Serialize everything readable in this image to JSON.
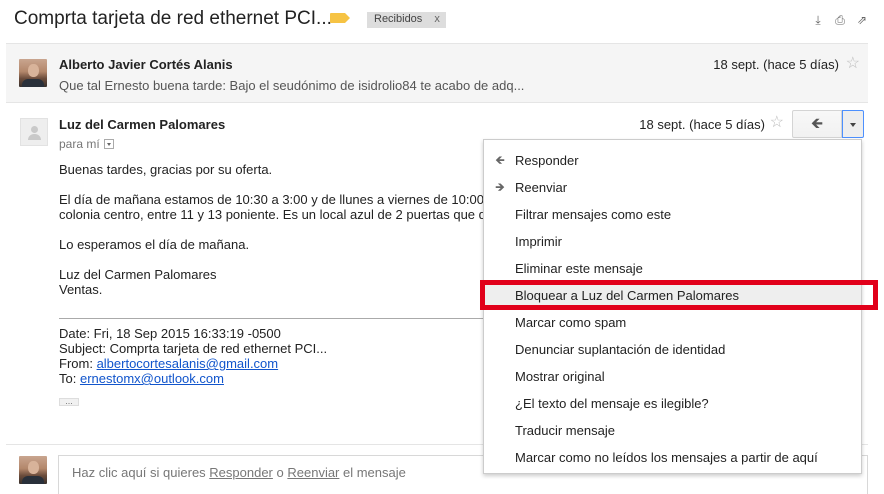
{
  "thread": {
    "subject": "Comprta tarjeta de red ethernet PCI...",
    "label_chip": "Recibidos",
    "label_chip_close": "x",
    "header_icons": [
      "download-icon",
      "print-icon",
      "open-new-window-icon"
    ]
  },
  "message1": {
    "sender": "Alberto Javier Cortés Alanis",
    "snippet": "Que tal Ernesto buena tarde: Bajo el seudónimo de isidrolio84 te acabo de adq...",
    "date": "18 sept. (hace 5 días)"
  },
  "message2": {
    "sender": "Luz del Carmen Palomares",
    "to": "para mí",
    "date": "18 sept. (hace 5 días)",
    "body": {
      "greeting": "Buenas tardes, gracias por su oferta.",
      "para_line1": "El día de mañana estamos de 10:30 a 3:00 y de llunes a viernes de 10:00",
      "para_line2": "colonia centro, entre 11 y 13 poniente. Es un local azul de 2 puertas que d",
      "closing": "Lo esperamos el día de mañana.",
      "signature_name": "Luz del Carmen Palomares",
      "signature_role": "Ventas."
    },
    "quoted": {
      "date_line": "Date: Fri, 18 Sep 2015 16:33:19 -0500",
      "subject_line": "Subject: Comprta tarjeta de red ethernet PCI...",
      "from_label": "From: ",
      "from_email": "albertocortesalanis@gmail.com",
      "to_label": "To: ",
      "to_email": "ernestomx@outlook.com",
      "expand": "..."
    }
  },
  "menu": {
    "items": [
      {
        "label": "Responder",
        "icon": "reply-icon"
      },
      {
        "label": "Reenviar",
        "icon": "forward-icon"
      },
      {
        "label": "Filtrar mensajes como este"
      },
      {
        "label": "Imprimir"
      },
      {
        "label": "Eliminar este mensaje"
      },
      {
        "label": "Bloquear a Luz del Carmen Palomares",
        "highlighted": true
      },
      {
        "label": "Marcar como spam"
      },
      {
        "label": "Denunciar suplantación de identidad"
      },
      {
        "label": "Mostrar original"
      },
      {
        "label": "¿El texto del mensaje es ilegible?"
      },
      {
        "label": "Traducir mensaje"
      },
      {
        "label": "Marcar como no leídos los mensajes a partir de aquí"
      }
    ],
    "annotation_color": "#e1001a"
  },
  "reply_box": {
    "prefix": "Haz clic aquí si quieres ",
    "reply_link": "Responder",
    "middle": " o ",
    "forward_link": "Reenviar",
    "suffix": " el mensaje"
  }
}
